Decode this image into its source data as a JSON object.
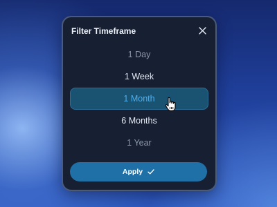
{
  "dialog": {
    "title": "Filter Timeframe",
    "close_icon": "close-icon"
  },
  "options": [
    {
      "label": "1 Day",
      "state": "faded"
    },
    {
      "label": "1 Week",
      "state": "normal"
    },
    {
      "label": "1 Month",
      "state": "selected"
    },
    {
      "label": "6 Months",
      "state": "normal"
    },
    {
      "label": "1 Year",
      "state": "faded"
    }
  ],
  "apply": {
    "label": "Apply",
    "icon": "checkmark-icon"
  },
  "cursor_icon": "hand-pointer-icon",
  "colors": {
    "panel": "#172033",
    "selected_bg": "#1a5272",
    "selected_text": "#52aee8",
    "apply_bg": "#1f70a6"
  }
}
